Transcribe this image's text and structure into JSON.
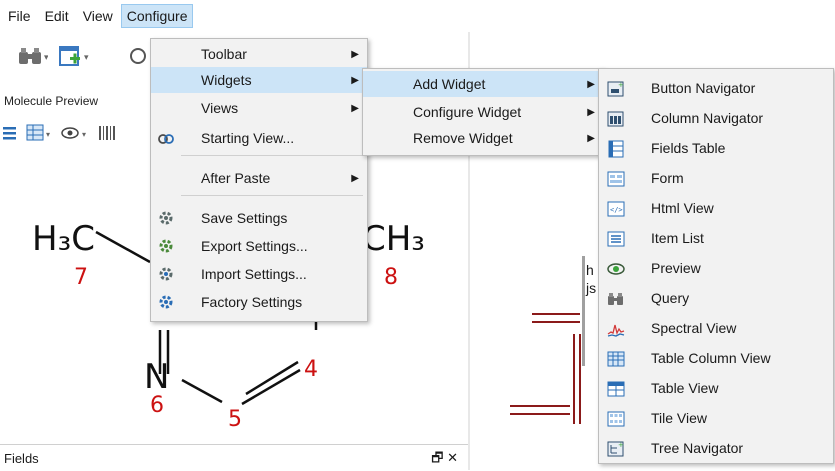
{
  "menubar": {
    "items": [
      "File",
      "Edit",
      "View",
      "Configure"
    ]
  },
  "panel": {
    "title": "Molecule Preview"
  },
  "molecule": {
    "atoms": [
      "H3C",
      "CH3",
      "N",
      "7",
      "8",
      "6",
      "5",
      "4"
    ],
    "label_h3c": "H₃C",
    "label_ch3": "CH₃",
    "label_n": "N",
    "num7": "7",
    "num8": "8",
    "num6": "6",
    "num5": "5",
    "num4": "4",
    "atom_color": "#111111",
    "index_color": "#cc1111"
  },
  "right": {
    "text1": "h",
    "text2": "js"
  },
  "fields": {
    "label": "Fields",
    "controls": "🗗 ✕"
  },
  "configure_menu": {
    "items": [
      {
        "label": "Toolbar",
        "submenu": true
      },
      {
        "label": "Widgets",
        "submenu": true,
        "highlighted": true
      },
      {
        "label": "Views",
        "submenu": true
      },
      {
        "label": "Starting View...",
        "icon": "starting-view-icon"
      },
      {
        "label": "After Paste",
        "submenu": true
      },
      {
        "label": "Save Settings",
        "icon": "save-settings-icon"
      },
      {
        "label": "Export Settings...",
        "icon": "export-settings-icon"
      },
      {
        "label": "Import Settings...",
        "icon": "import-settings-icon"
      },
      {
        "label": "Factory Settings",
        "icon": "factory-settings-icon"
      }
    ]
  },
  "widgets_menu": {
    "items": [
      {
        "label": "Add Widget",
        "submenu": true,
        "highlighted": true
      },
      {
        "label": "Configure Widget",
        "submenu": true
      },
      {
        "label": "Remove Widget",
        "submenu": true
      }
    ]
  },
  "add_widget_menu": {
    "items": [
      {
        "label": "Button Navigator",
        "icon": "button-navigator-icon"
      },
      {
        "label": "Column Navigator",
        "icon": "column-navigator-icon"
      },
      {
        "label": "Fields Table",
        "icon": "fields-table-icon"
      },
      {
        "label": "Form",
        "icon": "form-icon"
      },
      {
        "label": "Html View",
        "icon": "html-view-icon"
      },
      {
        "label": "Item List",
        "icon": "item-list-icon"
      },
      {
        "label": "Preview",
        "icon": "preview-icon"
      },
      {
        "label": "Query",
        "icon": "query-icon"
      },
      {
        "label": "Spectral View",
        "icon": "spectral-view-icon"
      },
      {
        "label": "Table Column View",
        "icon": "table-column-view-icon"
      },
      {
        "label": "Table View",
        "icon": "table-view-icon"
      },
      {
        "label": "Tile View",
        "icon": "tile-view-icon"
      },
      {
        "label": "Tree Navigator",
        "icon": "tree-navigator-icon"
      }
    ]
  },
  "colors": {
    "menu_bg": "#f2f2f2",
    "highlight": "#cce4f7",
    "bond_dark_red": "#8b1a1a"
  }
}
